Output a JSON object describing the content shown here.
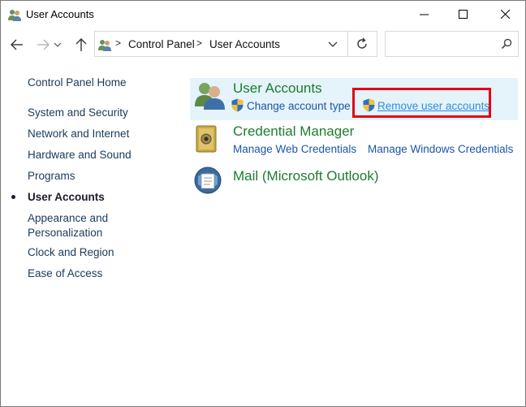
{
  "window": {
    "title": "User Accounts"
  },
  "address": {
    "crumbs": [
      "Control Panel",
      "User Accounts"
    ],
    "separator": ">"
  },
  "search": {
    "placeholder": ""
  },
  "leftnav": {
    "home": "Control Panel Home",
    "items": [
      "System and Security",
      "Network and Internet",
      "Hardware and Sound",
      "Programs",
      "User Accounts",
      "Appearance and",
      "Personalization",
      "Clock and Region",
      "Ease of Access"
    ],
    "active": "User Accounts"
  },
  "categories": {
    "user_accounts": {
      "title": "User Accounts",
      "links": [
        "Change account type",
        "Remove user accounts"
      ]
    },
    "credential_manager": {
      "title": "Credential Manager",
      "links": [
        "Manage Web Credentials",
        "Manage Windows Credentials"
      ]
    },
    "mail": {
      "title": "Mail (Microsoft Outlook)"
    }
  },
  "colors": {
    "category_title": "#1c7d2e",
    "link": "#1c55a8",
    "highlight_border": "#e30613",
    "selected_panel": "#e5f3fb"
  },
  "icons": {
    "title": "users-icon",
    "back": "arrow-left-icon",
    "forward": "arrow-right-icon",
    "up": "arrow-up-icon",
    "refresh": "refresh-icon",
    "search": "search-icon",
    "shield": "uac-shield-icon"
  }
}
